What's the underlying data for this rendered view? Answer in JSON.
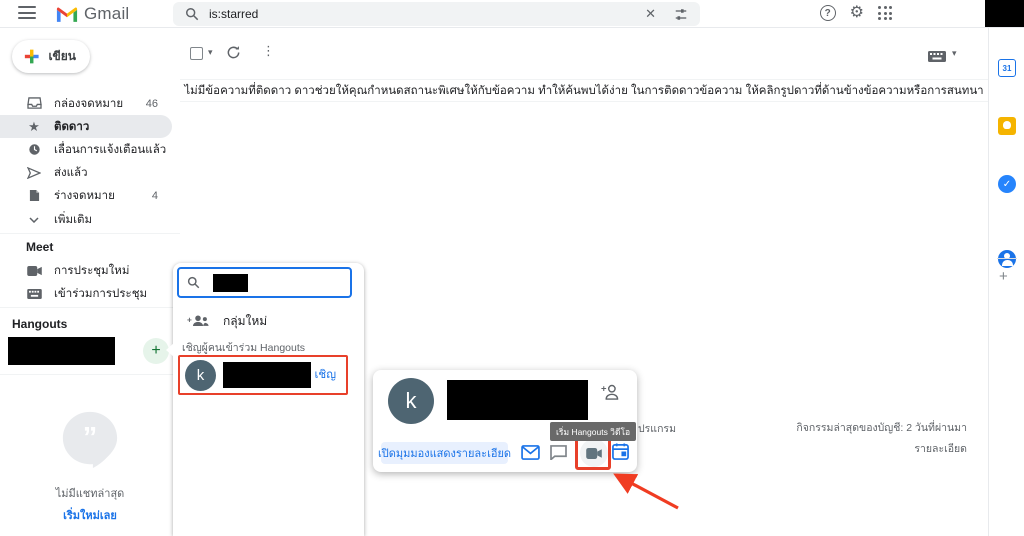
{
  "header": {
    "app_name": "Gmail",
    "search_value": "is:starred"
  },
  "sidebar": {
    "compose_label": "เขียน",
    "items": [
      {
        "label": "กล่องจดหมาย",
        "count": "46"
      },
      {
        "label": "ติดดาว",
        "count": ""
      },
      {
        "label": "เลื่อนการแจ้งเตือนแล้ว",
        "count": ""
      },
      {
        "label": "ส่งแล้ว",
        "count": ""
      },
      {
        "label": "ร่างจดหมาย",
        "count": "4"
      },
      {
        "label": "เพิ่มเติม",
        "count": ""
      }
    ],
    "meet_header": "Meet",
    "meet_items": [
      {
        "label": "การประชุมใหม่"
      },
      {
        "label": "เข้าร่วมการประชุม"
      }
    ],
    "hangouts_header": "Hangouts",
    "no_recent_chats": "ไม่มีแชทล่าสุด",
    "start_new": "เริ่มใหม่เลย"
  },
  "main": {
    "banner": "ไม่มีข้อความที่ติดดาว ดาวช่วยให้คุณกำหนดสถานะพิเศษให้กับข้อความ ทำให้ค้นพบได้ง่าย ในการติดดาวข้อความ ให้คลิกรูปดาวที่ด้านข้างข้อความหรือการสนทนา",
    "footer_partial": "ปรแกรม",
    "last_activity": "กิจกรรมล่าสุดของบัญชี: 2 วันที่ผ่านมา",
    "details": "รายละเอียด"
  },
  "search_popup": {
    "new_group": "กลุ่มใหม่",
    "invite_section": "เชิญผู้คนเข้าร่วม Hangouts",
    "contact_initial": "k",
    "invite": "เชิญ"
  },
  "contact_card": {
    "initial": "k",
    "tooltip": "เริ่ม Hangouts วิดีโอ",
    "open_detail": "เปิดมุมมองแสดงรายละเอียด"
  },
  "right_panel": {
    "calendar_label": "31",
    "tasks_check": "✓",
    "add_label": "+"
  },
  "colors": {
    "accent_blue": "#1a73e8",
    "highlight_red": "#e8402a",
    "avatar_slate": "#4e6572",
    "plus_green": "#137333"
  }
}
